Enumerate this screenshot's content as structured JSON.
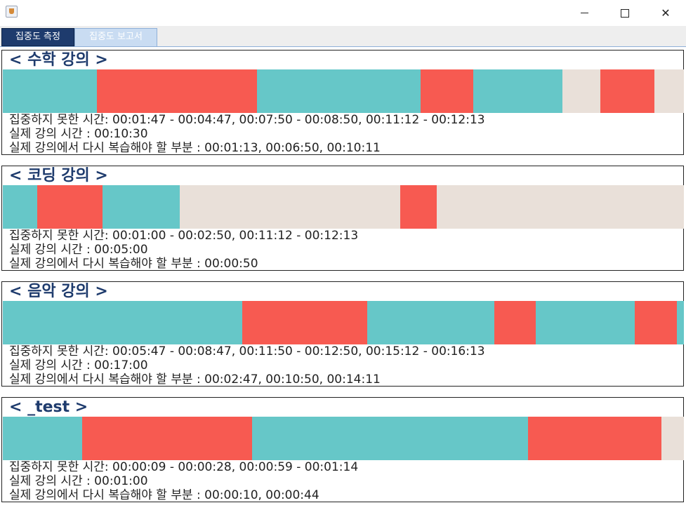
{
  "window": {
    "title": ""
  },
  "tabs": [
    {
      "label": "집중도 측정",
      "selected": false
    },
    {
      "label": "집중도 보고서",
      "selected": true
    }
  ],
  "colors": {
    "focused": "#66c7c8",
    "unfocused": "#f75a51",
    "no_data": "#e9e0d9",
    "title_text": "#1e3b6d"
  },
  "legend_note": "teal = focused, red = unfocused, beige = remaining lecture time",
  "lectures": [
    {
      "title": "< 수학 강의 >",
      "timeline": [
        {
          "state": "focused",
          "fraction": 0.138
        },
        {
          "state": "unfocused",
          "fraction": 0.235
        },
        {
          "state": "focused",
          "fraction": 0.24
        },
        {
          "state": "unfocused",
          "fraction": 0.078
        },
        {
          "state": "focused",
          "fraction": 0.131
        },
        {
          "state": "none",
          "fraction": 0.055
        },
        {
          "state": "unfocused",
          "fraction": 0.08
        },
        {
          "state": "none",
          "fraction": 0.043
        }
      ],
      "unfocused_line": "집중하지 못한 시간: 00:01:47 - 00:04:47, 00:07:50 - 00:08:50, 00:11:12 - 00:12:13",
      "duration_line": "실제 강의 시간 : 00:10:30",
      "review_line": "실제 강의에서 다시 복습해야 할 부분 : 00:01:13, 00:06:50, 00:10:11"
    },
    {
      "title": "< 코딩 강의 >",
      "timeline": [
        {
          "state": "focused",
          "fraction": 0.051
        },
        {
          "state": "unfocused",
          "fraction": 0.095
        },
        {
          "state": "focused",
          "fraction": 0.114
        },
        {
          "state": "none",
          "fraction": 0.323
        },
        {
          "state": "unfocused",
          "fraction": 0.054
        },
        {
          "state": "none",
          "fraction": 0.363
        }
      ],
      "unfocused_line": "집중하지 못한 시간: 00:01:00 - 00:02:50, 00:11:12 - 00:12:13",
      "duration_line": "실제 강의 시간 : 00:05:00",
      "review_line": "실제 강의에서 다시 복습해야 할 부분 : 00:00:50"
    },
    {
      "title": "< 음악 강의 >",
      "timeline": [
        {
          "state": "focused",
          "fraction": 0.352
        },
        {
          "state": "unfocused",
          "fraction": 0.183
        },
        {
          "state": "focused",
          "fraction": 0.187
        },
        {
          "state": "unfocused",
          "fraction": 0.06
        },
        {
          "state": "focused",
          "fraction": 0.146
        },
        {
          "state": "unfocused",
          "fraction": 0.062
        },
        {
          "state": "focused",
          "fraction": 0.01
        }
      ],
      "unfocused_line": "집중하지 못한 시간: 00:05:47 - 00:08:47, 00:11:50 - 00:12:50, 00:15:12 - 00:16:13",
      "duration_line": "실제 강의 시간 : 00:17:00",
      "review_line": "실제 강의에서 다시 복습해야 할 부분 : 00:02:47, 00:10:50, 00:14:11"
    },
    {
      "title": "< _test >",
      "timeline": [
        {
          "state": "focused",
          "fraction": 0.116
        },
        {
          "state": "unfocused",
          "fraction": 0.25
        },
        {
          "state": "focused",
          "fraction": 0.405
        },
        {
          "state": "unfocused",
          "fraction": 0.196
        },
        {
          "state": "none",
          "fraction": 0.033
        }
      ],
      "unfocused_line": "집중하지 못한 시간: 00:00:09 - 00:00:28, 00:00:59 - 00:01:14",
      "duration_line": "실제 강의 시간 : 00:01:00",
      "review_line": "실제 강의에서 다시 복습해야 할 부분 : 00:00:10, 00:00:44"
    }
  ]
}
